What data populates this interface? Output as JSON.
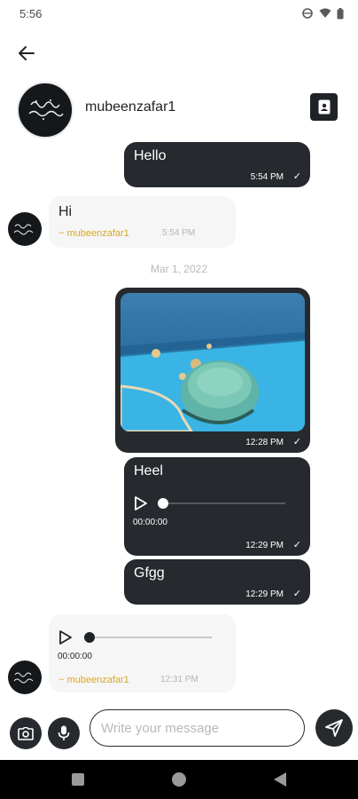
{
  "status_bar": {
    "time": "5:56",
    "icons": [
      "cast-icon",
      "wifi-icon",
      "battery-icon"
    ]
  },
  "contact": {
    "name": "mubeenzafar1"
  },
  "date_separator": "Mar 1, 2022",
  "messages": [
    {
      "direction": "out",
      "type": "text",
      "text": "Hello",
      "time": "5:54 PM",
      "tick": "✓"
    },
    {
      "direction": "in",
      "type": "text",
      "text": "Hi",
      "sender": "~ mubeenzafar1",
      "time": "5:54 PM"
    },
    {
      "direction": "out",
      "type": "image",
      "time": "12:28 PM",
      "tick": "✓"
    },
    {
      "direction": "out",
      "type": "audio",
      "text": "Heel",
      "duration": "00:00:00",
      "time": "12:29 PM",
      "tick": "✓"
    },
    {
      "direction": "out",
      "type": "text",
      "text": "Gfgg",
      "time": "12:29 PM",
      "tick": "✓"
    },
    {
      "direction": "in",
      "type": "audio",
      "duration": "00:00:00",
      "sender": "~ mubeenzafar1",
      "time": "12:31 PM"
    }
  ],
  "composer": {
    "placeholder": "Write your message"
  },
  "colors": {
    "bubble_out": "#262a2f",
    "bubble_in": "#f6f6f6",
    "sender_name": "#d8a82a",
    "nav_bar": "#000000"
  }
}
